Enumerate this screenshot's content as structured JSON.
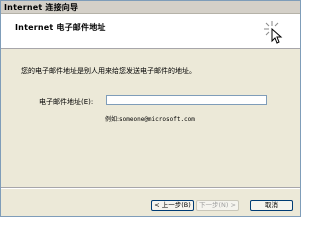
{
  "window": {
    "title": "Internet 连接向导"
  },
  "header": {
    "title": "Internet 电子邮件地址",
    "icon": "wizard-cursor-icon"
  },
  "content": {
    "intro": "您的电子邮件地址是别人用来给您发送电子邮件的地址。",
    "email_label": "电子邮件地址(E):",
    "email_value": "",
    "example_prefix": "例如:",
    "example_address": "someone@microsoft.com"
  },
  "buttons": {
    "prev": "< 上一步(B)",
    "next": "下一步(N) >",
    "cancel": "取消"
  },
  "colors": {
    "dialog_bg": "#ece9d8",
    "header_bg": "#ffffff",
    "input_border": "#7f9db9",
    "button_border": "#003c74",
    "disabled_text": "#a0a0a0"
  }
}
